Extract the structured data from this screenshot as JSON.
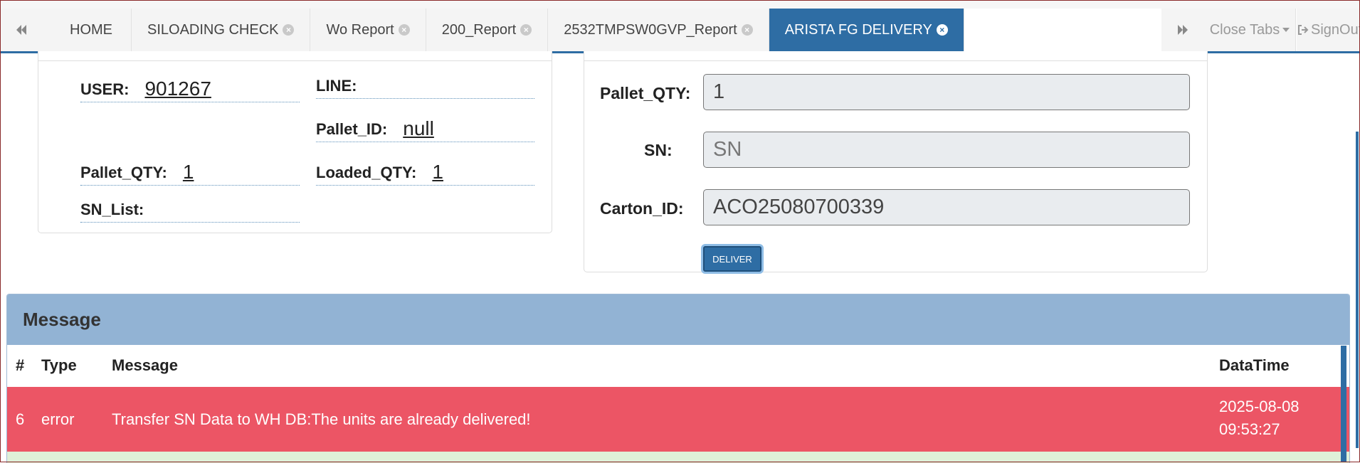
{
  "tabs": [
    {
      "label": "HOME",
      "closable": false,
      "active": false
    },
    {
      "label": "SILOADING CHECK",
      "closable": true,
      "active": false
    },
    {
      "label": "Wo Report",
      "closable": true,
      "active": false
    },
    {
      "label": "200_Report",
      "closable": true,
      "active": false
    },
    {
      "label": "2532TMPSW0GVP_Report",
      "closable": true,
      "active": false
    },
    {
      "label": "ARISTA FG DELIVERY",
      "closable": true,
      "active": true
    }
  ],
  "toolbar": {
    "close_tabs": "Close Tabs",
    "sign_out": "SignOut"
  },
  "info": {
    "user_label": "USER:",
    "user_value": "901267",
    "line_label": "LINE:",
    "line_value": "",
    "pallet_id_label": "Pallet_ID:",
    "pallet_id_value": "null",
    "pallet_qty_label": "Pallet_QTY:",
    "pallet_qty_value": "1",
    "loaded_qty_label": "Loaded_QTY:",
    "loaded_qty_value": "1",
    "sn_list_label": "SN_List:",
    "sn_list_value": ""
  },
  "form": {
    "pallet_qty_label": "Pallet_QTY:",
    "pallet_qty_value": "1",
    "sn_label": "SN:",
    "sn_placeholder": "SN",
    "carton_id_label": "Carton_ID:",
    "carton_id_value": "ACO25080700339",
    "deliver_button": "DELIVER"
  },
  "messages": {
    "title": "Message",
    "columns": {
      "num": "#",
      "type": "Type",
      "message": "Message",
      "datatime": "DataTime"
    },
    "rows": [
      {
        "num": "6",
        "type": "error",
        "message": "Transfer SN Data to WH DB:The units are already delivered!",
        "date": "2025-08-08",
        "time": "09:53:27"
      }
    ]
  },
  "colors": {
    "accent": "#2e6da4",
    "message_header": "#92b3d4",
    "error_row": "#ec5565",
    "success_row": "#dff0d8"
  }
}
